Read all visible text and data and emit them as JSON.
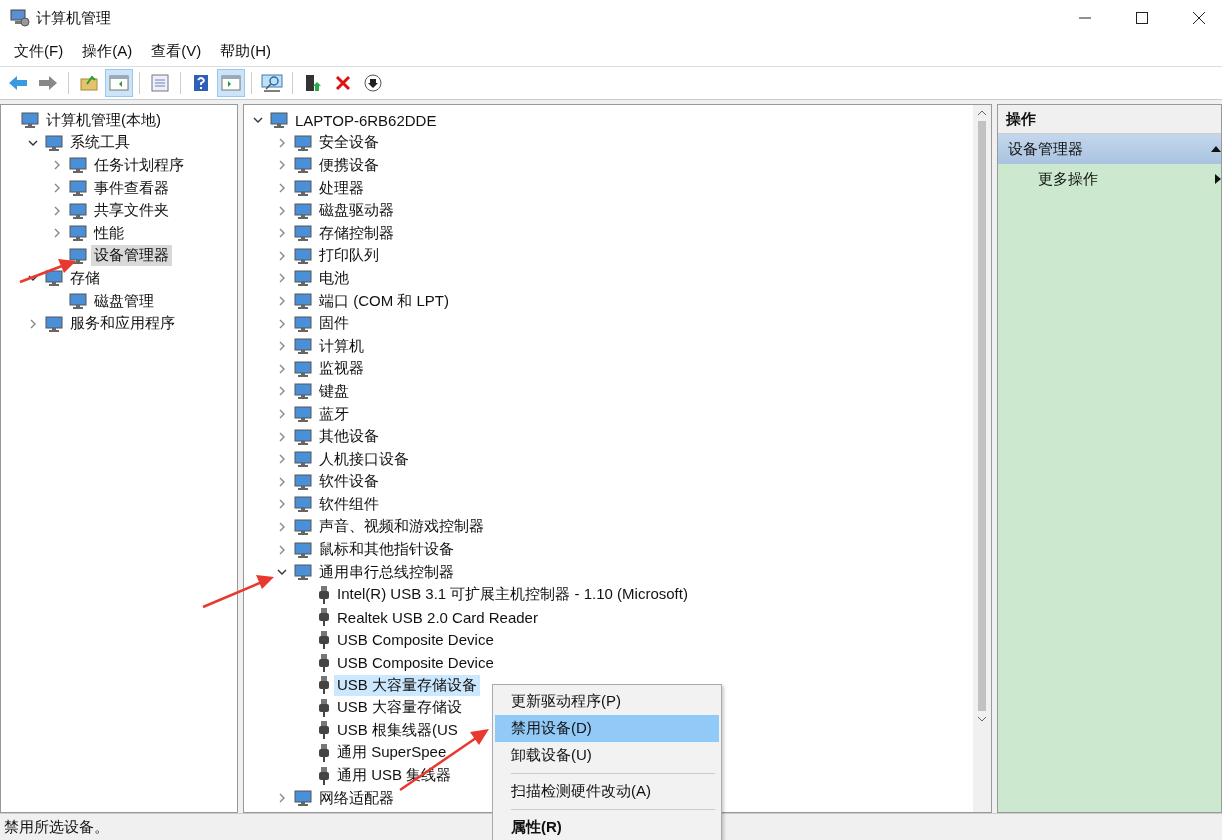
{
  "window": {
    "title": "计算机管理"
  },
  "menu_bar": [
    "文件(F)",
    "操作(A)",
    "查看(V)",
    "帮助(H)"
  ],
  "toolbar": [
    {
      "kind": "back",
      "pressed": false
    },
    {
      "kind": "forward",
      "pressed": false
    },
    {
      "kind": "separator"
    },
    {
      "kind": "up",
      "pressed": false
    },
    {
      "kind": "tree",
      "pressed": true
    },
    {
      "kind": "separator"
    },
    {
      "kind": "export",
      "pressed": false
    },
    {
      "kind": "separator"
    },
    {
      "kind": "help",
      "pressed": false
    },
    {
      "kind": "pane",
      "pressed": true
    },
    {
      "kind": "separator"
    },
    {
      "kind": "scan",
      "pressed": false
    },
    {
      "kind": "separator"
    },
    {
      "kind": "update",
      "pressed": false
    },
    {
      "kind": "remove",
      "pressed": false
    },
    {
      "kind": "download",
      "pressed": false
    }
  ],
  "nav_tree": [
    {
      "label": "计算机管理(本地)",
      "selected": false,
      "children": [
        {
          "label": "系统工具",
          "expanded": true,
          "selected": false,
          "children": [
            {
              "label": "任务计划程序",
              "expanded": false,
              "selected": false
            },
            {
              "label": "事件查看器",
              "expanded": false,
              "selected": false
            },
            {
              "label": "共享文件夹",
              "expanded": false,
              "selected": false
            },
            {
              "label": "性能",
              "expanded": false,
              "selected": false
            },
            {
              "label": "设备管理器",
              "selected": true
            }
          ]
        },
        {
          "label": "存储",
          "expanded": true,
          "selected": false,
          "children": [
            {
              "label": "磁盘管理",
              "selected": false
            }
          ]
        },
        {
          "label": "服务和应用程序",
          "expanded": false,
          "selected": false
        }
      ]
    }
  ],
  "device_tree": [
    {
      "label": "LAPTOP-6RB62DDE",
      "expanded": true,
      "selected": false,
      "children": [
        {
          "label": "安全设备",
          "expanded": false,
          "selected": false
        },
        {
          "label": "便携设备",
          "expanded": false,
          "selected": false
        },
        {
          "label": "处理器",
          "expanded": false,
          "selected": false
        },
        {
          "label": "磁盘驱动器",
          "expanded": false,
          "selected": false
        },
        {
          "label": "存储控制器",
          "expanded": false,
          "selected": false
        },
        {
          "label": "打印队列",
          "expanded": false,
          "selected": false
        },
        {
          "label": "电池",
          "expanded": false,
          "selected": false
        },
        {
          "label": "端口 (COM 和 LPT)",
          "expanded": false,
          "selected": false
        },
        {
          "label": "固件",
          "expanded": false,
          "selected": false
        },
        {
          "label": "计算机",
          "expanded": false,
          "selected": false
        },
        {
          "label": "监视器",
          "expanded": false,
          "selected": false
        },
        {
          "label": "键盘",
          "expanded": false,
          "selected": false
        },
        {
          "label": "蓝牙",
          "expanded": false,
          "selected": false
        },
        {
          "label": "其他设备",
          "expanded": false,
          "selected": false
        },
        {
          "label": "人机接口设备",
          "expanded": false,
          "selected": false
        },
        {
          "label": "软件设备",
          "expanded": false,
          "selected": false
        },
        {
          "label": "软件组件",
          "expanded": false,
          "selected": false
        },
        {
          "label": "声音、视频和游戏控制器",
          "expanded": false,
          "selected": false
        },
        {
          "label": "鼠标和其他指针设备",
          "expanded": false,
          "selected": false
        },
        {
          "label": "通用串行总线控制器",
          "expanded": true,
          "selected": false,
          "children": [
            {
              "label": "Intel(R) USB 3.1 可扩展主机控制器 - 1.10 (Microsoft)",
              "selected": false
            },
            {
              "label": "Realtek USB 2.0 Card Reader",
              "selected": false
            },
            {
              "label": "USB Composite Device",
              "selected": false
            },
            {
              "label": "USB Composite Device",
              "selected": false
            },
            {
              "label": "USB 大容量存储设备",
              "selected": true
            },
            {
              "label": "USB 大容量存储设",
              "selected": false
            },
            {
              "label": "USB 根集线器(US",
              "selected": false
            },
            {
              "label": "通用 SuperSpee",
              "selected": false
            },
            {
              "label": "通用 USB 集线器",
              "selected": false
            }
          ]
        },
        {
          "label": "网络适配器",
          "expanded": false,
          "selected": false
        }
      ]
    }
  ],
  "actions_pane": {
    "title": "操作",
    "section": {
      "label": "设备管理器",
      "expanded": true
    },
    "items": [
      "更多操作"
    ]
  },
  "context_menu": [
    {
      "kind": "item",
      "label": "更新驱动程序(P)",
      "selected": false
    },
    {
      "kind": "item",
      "label": "禁用设备(D)",
      "selected": true
    },
    {
      "kind": "item",
      "label": "卸载设备(U)",
      "selected": false
    },
    {
      "kind": "separator"
    },
    {
      "kind": "item",
      "label": "扫描检测硬件改动(A)",
      "selected": false
    },
    {
      "kind": "separator"
    },
    {
      "kind": "default",
      "label": "属性(R)",
      "selected": false
    }
  ],
  "status_bar": "禁用所选设备。"
}
